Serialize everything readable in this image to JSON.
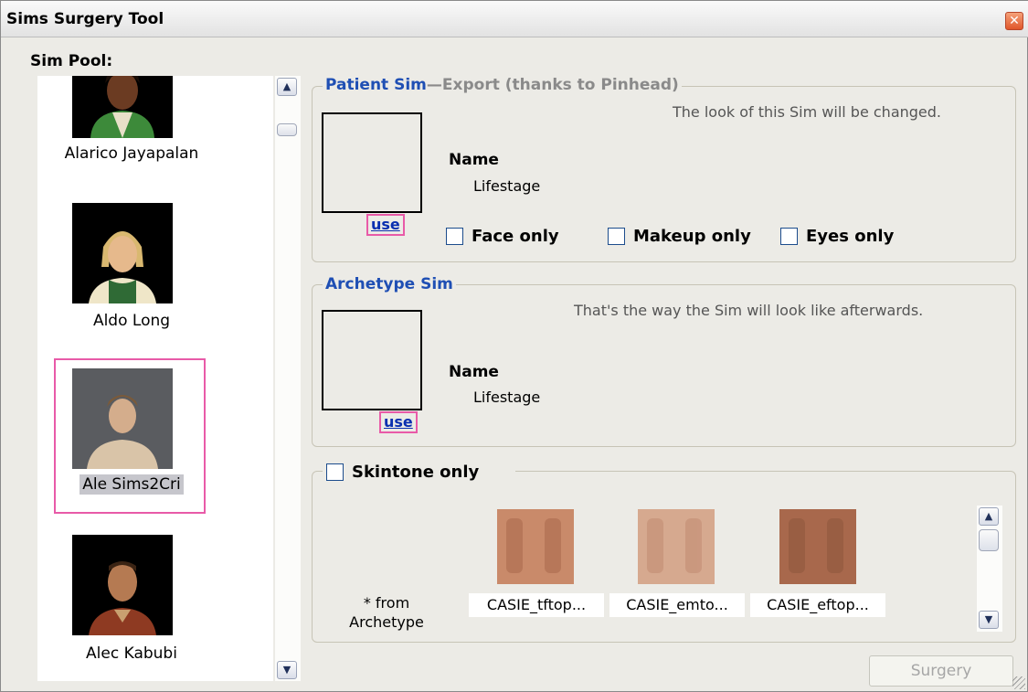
{
  "window": {
    "title": "Sims Surgery Tool",
    "close_glyph": "✕"
  },
  "pool": {
    "label": "Sim Pool:",
    "sims": [
      {
        "name": "Alarico Jayapalan",
        "selected": false
      },
      {
        "name": "Aldo Long",
        "selected": false
      },
      {
        "name": "Ale Sims2Cri",
        "selected": true
      },
      {
        "name": "Alec Kabubi",
        "selected": false
      }
    ]
  },
  "patient": {
    "legend": "Patient Sim",
    "legend_extra": "Export (thanks to Pinhead)",
    "description": "The look of this Sim will be changed.",
    "use_label": "use",
    "name_label": "Name",
    "lifestage_label": "Lifestage",
    "checkboxes": [
      "Face only",
      "Makeup only",
      "Eyes only"
    ]
  },
  "archetype": {
    "legend": "Archetype Sim",
    "description": "That's the way the Sim will look like afterwards.",
    "use_label": "use",
    "name_label": "Name",
    "lifestage_label": "Lifestage"
  },
  "skintone": {
    "checkbox_label": "Skintone only",
    "from_line1": "* from",
    "from_line2": "Archetype",
    "tones": [
      {
        "label": "CASIE_tftop...",
        "color": "#c98a6a"
      },
      {
        "label": "CASIE_emto...",
        "color": "#d6a98f"
      },
      {
        "label": "CASIE_eftop...",
        "color": "#a8684c"
      }
    ]
  },
  "actions": {
    "surgery_label": "Surgery"
  },
  "colors": {
    "accent": "#1f4fb4",
    "highlight": "#e85aa8",
    "link": "#0a2fb0"
  }
}
